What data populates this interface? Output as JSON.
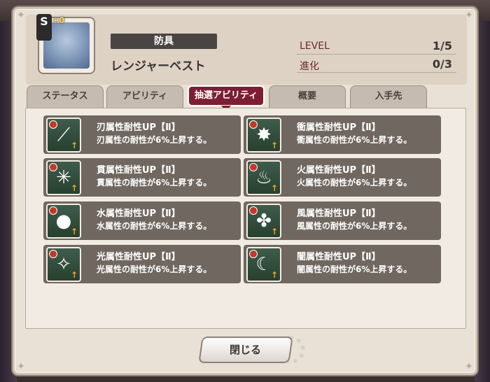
{
  "item": {
    "category": "防具",
    "name": "レンジャーベスト",
    "rarity": "S",
    "plus": "+0",
    "stats": [
      {
        "label": "LEVEL",
        "value": "1/5"
      },
      {
        "label": "進化",
        "value": "0/3"
      }
    ]
  },
  "tabs": [
    {
      "label": "ステータス"
    },
    {
      "label": "アビリティ"
    },
    {
      "label": "抽選アビリティ"
    },
    {
      "label": "概要"
    },
    {
      "label": "入手先"
    }
  ],
  "active_tab_index": 2,
  "abilities": [
    {
      "title": "刃属性耐性UP【Ⅱ】",
      "desc": "刃属性の耐性が6%上昇する。",
      "icon": "blade-icon"
    },
    {
      "title": "衝属性耐性UP【Ⅱ】",
      "desc": "衝属性の耐性が6%上昇する。",
      "icon": "impact-icon"
    },
    {
      "title": "貫属性耐性UP【Ⅱ】",
      "desc": "貫属性の耐性が6%上昇する。",
      "icon": "pierce-icon"
    },
    {
      "title": "火属性耐性UP【Ⅱ】",
      "desc": "火属性の耐性が6%上昇する。",
      "icon": "fire-icon"
    },
    {
      "title": "水属性耐性UP【Ⅱ】",
      "desc": "水属性の耐性が6%上昇する。",
      "icon": "water-icon"
    },
    {
      "title": "風属性耐性UP【Ⅱ】",
      "desc": "風属性の耐性が6%上昇する。",
      "icon": "wind-icon"
    },
    {
      "title": "光属性耐性UP【Ⅱ】",
      "desc": "光属性の耐性が6%上昇する。",
      "icon": "light-icon"
    },
    {
      "title": "闇属性耐性UP【Ⅱ】",
      "desc": "闇属性の耐性が6%上昇する。",
      "icon": "dark-icon"
    }
  ],
  "close_label": "閉じる",
  "colors": {
    "accent": "#7d1f33",
    "ability_bg": "#6f6760"
  }
}
